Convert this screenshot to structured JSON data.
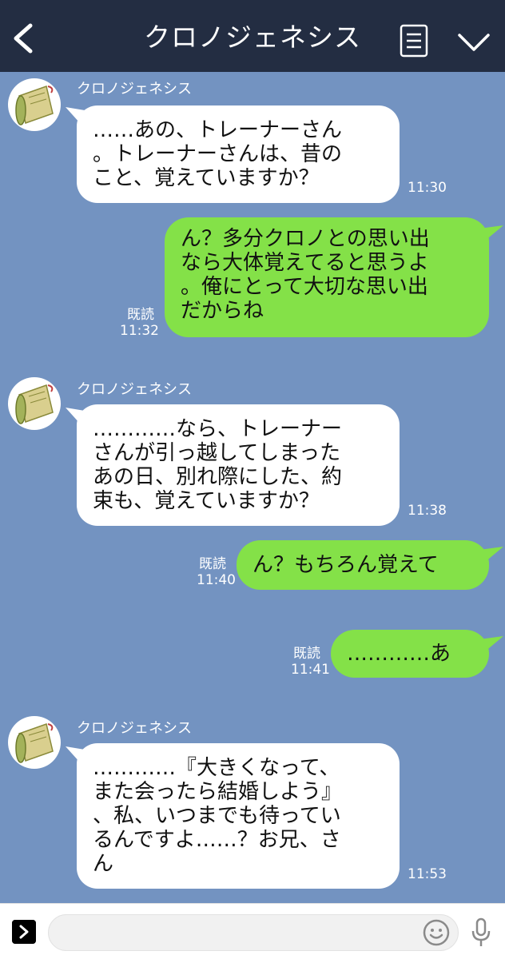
{
  "header": {
    "title": "クロノジェネシス"
  },
  "messages": [
    {
      "sender": "クロノジェネシス",
      "lines": [
        "……あの、トレーナーさん",
        "。トレーナーさんは、昔の",
        "こと、覚えていますか？"
      ],
      "time": "11:30"
    },
    {
      "lines": [
        "ん？多分クロノとの思い出",
        "なら大体覚えてると思うよ",
        "。俺にとって大切な思い出",
        "だからね"
      ],
      "read": "既読",
      "time": "11:32"
    },
    {
      "sender": "クロノジェネシス",
      "lines": [
        "…………なら、トレーナー",
        "さんが引っ越してしまった",
        "あの日、別れ際にした、約",
        "束も、覚えていますか？"
      ],
      "time": "11:38"
    },
    {
      "lines": [
        "ん？もちろん覚えて"
      ],
      "read": "既読",
      "time": "11:40"
    },
    {
      "lines": [
        "…………あ"
      ],
      "read": "既読",
      "time": "11:41"
    },
    {
      "sender": "クロノジェネシス",
      "lines": [
        "…………『大きくなって、",
        "また会ったら結婚しよう』",
        "、私、いつまでも待ってい",
        "るんですよ……？お兄、さ",
        "ん"
      ],
      "time": "11:53"
    }
  ],
  "colors": {
    "header_bg": "#232d42",
    "chat_bg": "#7393c1",
    "outgoing_bubble": "#84e148",
    "incoming_bubble": "#ffffff"
  },
  "icons": {
    "back": "chevron-left-icon",
    "menu": "notes-icon",
    "collapse": "chevron-down-icon",
    "plus": "expand-icon",
    "emoji": "smiley-icon",
    "mic": "microphone-icon"
  }
}
